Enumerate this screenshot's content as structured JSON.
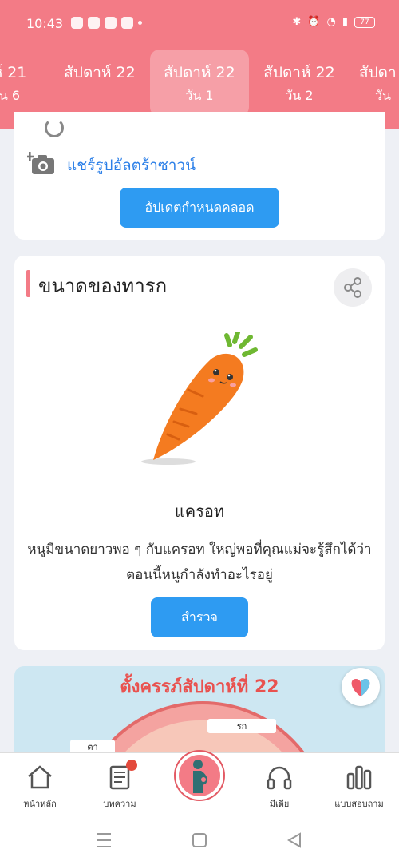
{
  "status_bar": {
    "time": "10:43",
    "battery": "77"
  },
  "week_tabs": [
    {
      "line1": "ห์ 21",
      "line2": "น 6"
    },
    {
      "line1": "สัปดาห์ 22",
      "line2": ""
    },
    {
      "line1": "สัปดาห์ 22",
      "line2": "วัน 1"
    },
    {
      "line1": "สัปดาห์ 22",
      "line2": "วัน 2"
    },
    {
      "line1": "สัปดา",
      "line2": "วัน"
    }
  ],
  "share_ultrasound_label": "แชร์รูปอัลตร้าซาวน์",
  "update_due_date_button": "อัปเดตกำหนดคลอด",
  "baby_size": {
    "title": "ขนาดของทารก",
    "fruit_name": "แครอท",
    "description": "หนูมีขนาดยาวพอ ๆ กับแครอท ใหญ่พอที่คุณแม่จะรู้สึกได้ว่าตอนนี้หนูกำลังทำอะไรอยู่",
    "explore_button": "สำรวจ"
  },
  "pregnancy_banner": {
    "title": "ตั้งครรภ์สัปดาห์ที่ 22",
    "label_a": "ตา",
    "label_b": "รก"
  },
  "bottom_nav": [
    {
      "label": "หน้าหลัก"
    },
    {
      "label": "บทความ"
    },
    {
      "label": ""
    },
    {
      "label": "มีเดีย"
    },
    {
      "label": "แบบสอบถาม"
    }
  ],
  "colors": {
    "header": "#f37b86",
    "primary_button": "#2e9bf2",
    "link": "#2b7fe8",
    "accent_red": "#e9524f"
  }
}
